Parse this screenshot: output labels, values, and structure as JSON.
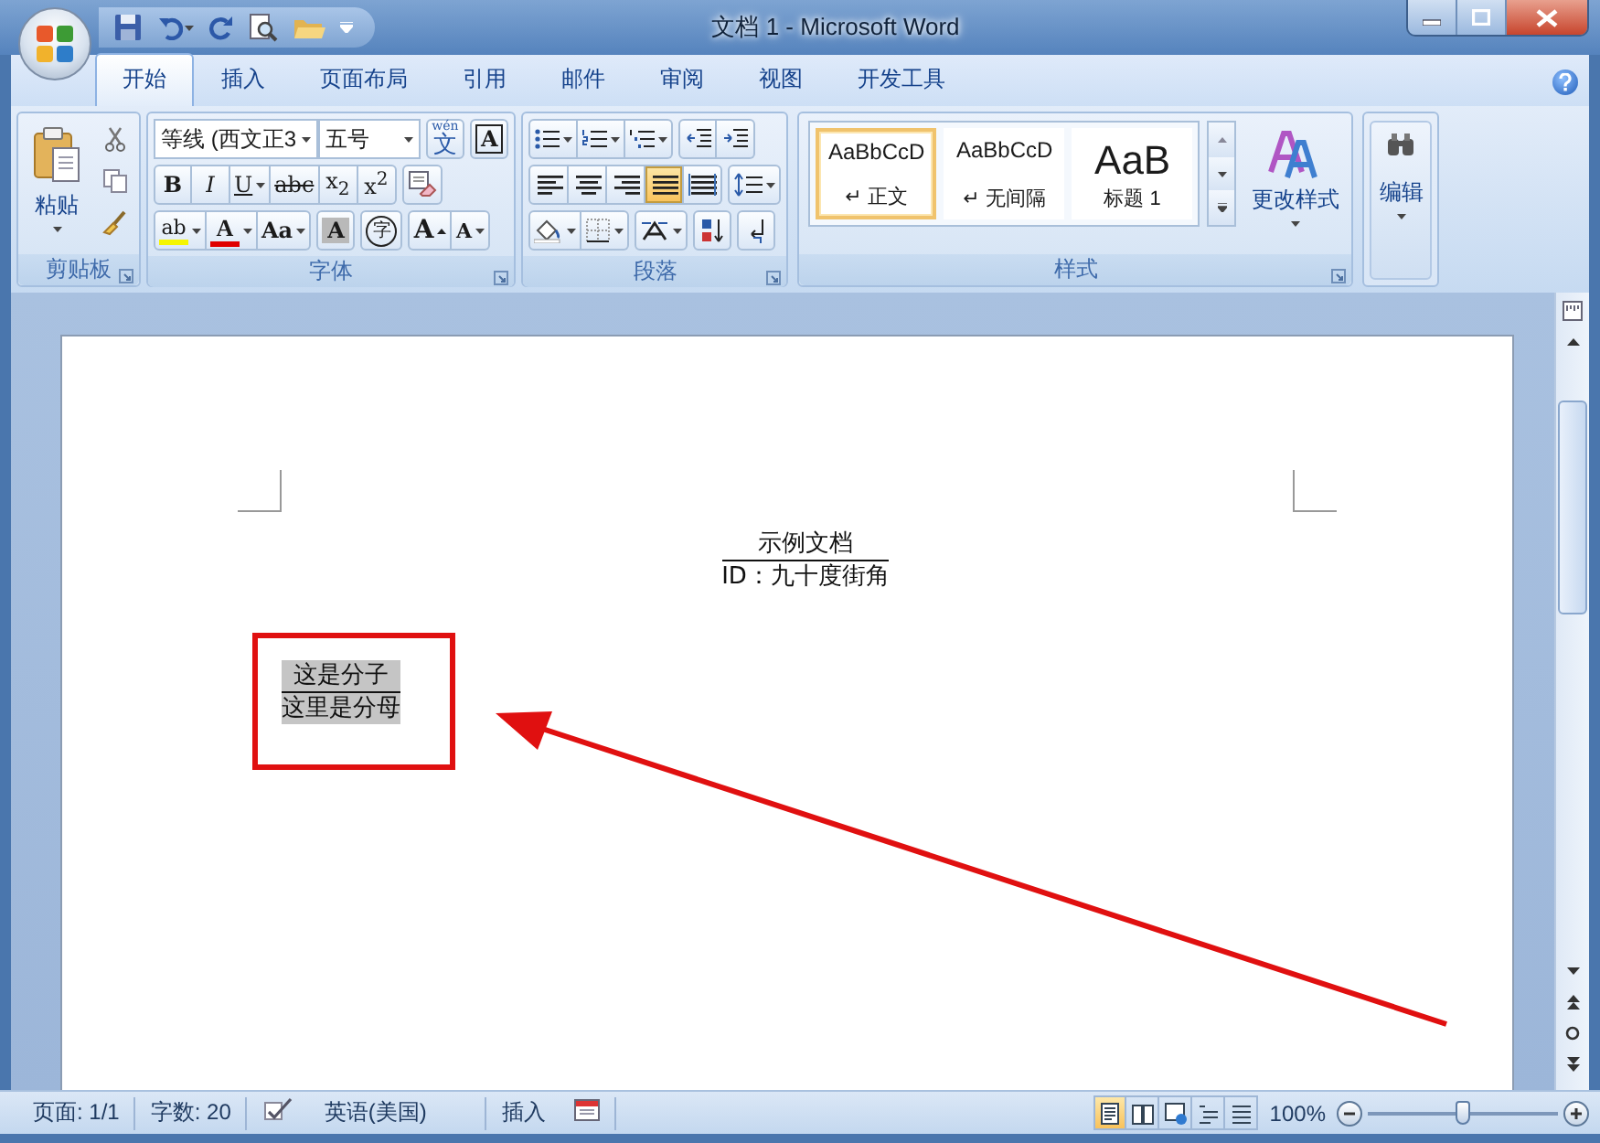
{
  "window": {
    "title": "文档 1 - Microsoft Word"
  },
  "tabs": [
    {
      "label": "开始",
      "selected": true
    },
    {
      "label": "插入",
      "selected": false
    },
    {
      "label": "页面布局",
      "selected": false
    },
    {
      "label": "引用",
      "selected": false
    },
    {
      "label": "邮件",
      "selected": false
    },
    {
      "label": "审阅",
      "selected": false
    },
    {
      "label": "视图",
      "selected": false
    },
    {
      "label": "开发工具",
      "selected": false
    }
  ],
  "clipboard": {
    "label": "剪贴板",
    "paste": "粘贴"
  },
  "font": {
    "label": "字体",
    "name": "等线 (西文正3",
    "size": "五号",
    "phonetic": {
      "pinyin": "wén",
      "char": "文"
    },
    "border_char": "A",
    "format_buttons": [
      {
        "kind": "bold",
        "label": "B",
        "menu": false
      },
      {
        "kind": "italic",
        "label": "I",
        "menu": false
      },
      {
        "kind": "underline",
        "label": "U",
        "menu": true
      },
      {
        "kind": "strike",
        "label": "abc",
        "menu": false
      },
      {
        "kind": "sub",
        "label": "x$_{2}$",
        "menu": false
      },
      {
        "kind": "sup",
        "label": "x$^{2}$",
        "menu": false
      }
    ],
    "effect_buttons": [
      {
        "kind": "highlight",
        "label": "ab",
        "menu": true
      },
      {
        "kind": "color",
        "label": "A",
        "menu": true
      },
      {
        "kind": "case",
        "label": "Aa",
        "menu": true
      },
      {
        "kind": "shade",
        "label": "A",
        "menu": false
      },
      {
        "kind": "enclose",
        "label": "字",
        "menu": false
      },
      {
        "kind": "grow",
        "label": "A",
        "menu": false
      },
      {
        "kind": "shrink",
        "label": "A",
        "menu": false
      }
    ]
  },
  "paragraph": {
    "label": "段落",
    "align": [
      {
        "kind": "left",
        "selected": false
      },
      {
        "kind": "center",
        "selected": false
      },
      {
        "kind": "right",
        "selected": false
      },
      {
        "kind": "justify",
        "selected": true
      },
      {
        "kind": "distributed",
        "selected": false
      }
    ]
  },
  "styles": {
    "label": "样式",
    "items": [
      {
        "sample": "AaBbCcD",
        "name": "↵ 正文",
        "kind": "normal",
        "selected": true
      },
      {
        "sample": "AaBbCcD",
        "name": "↵ 无间隔",
        "kind": "normal",
        "selected": false
      },
      {
        "sample": "AaB",
        "name": "标题 1",
        "kind": "heading",
        "selected": false
      }
    ],
    "change": "更改样式"
  },
  "editing": {
    "label": "编辑"
  },
  "document": {
    "equations": [
      {
        "numerator": "示例文档",
        "denominator": "ID：九十度街角",
        "highlighted": false
      },
      {
        "numerator": "这是分子",
        "denominator": "这里是分母",
        "highlighted": true
      }
    ]
  },
  "status_bar": {
    "page": "页面: 1/1",
    "words": "字数: 20",
    "language": "英语(美国)",
    "mode": "插入",
    "views": [
      {
        "kind": "print",
        "selected": true
      },
      {
        "kind": "reading",
        "selected": false
      },
      {
        "kind": "web",
        "selected": false
      },
      {
        "kind": "outline",
        "selected": false
      },
      {
        "kind": "draft",
        "selected": false
      }
    ],
    "zoom": "100%",
    "zoom_slider": {
      "level": 0.5
    }
  }
}
